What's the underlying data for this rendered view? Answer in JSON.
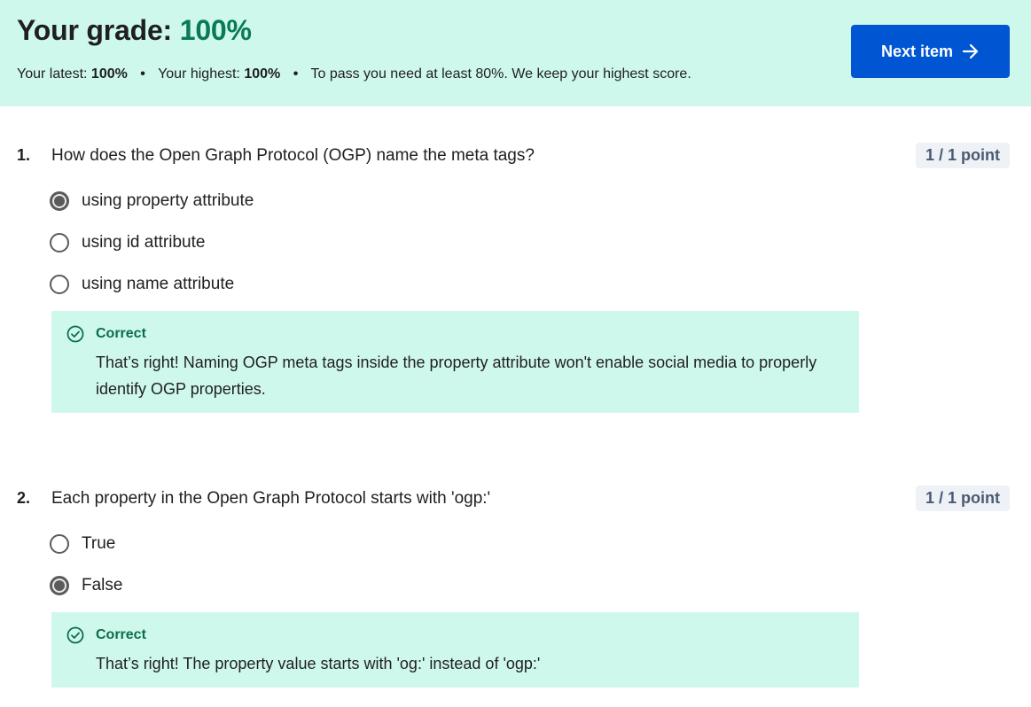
{
  "header": {
    "grade_label": "Your grade:",
    "grade_value": "100%",
    "latest_label": "Your latest:",
    "latest_value": "100%",
    "highest_label": "Your highest:",
    "highest_value": "100%",
    "separator": "•",
    "pass_note": "To pass you need at least 80%. We keep your highest score.",
    "next_button_label": "Next item",
    "next_button_icon": "arrow-right-icon",
    "banner_color": "#cff8ec",
    "accent_color": "#0056d2",
    "grade_color": "#0a7a55"
  },
  "questions": [
    {
      "number": "1.",
      "text": "How does the Open Graph Protocol (OGP) name the meta tags?",
      "points": "1 / 1 point",
      "options": [
        {
          "label": "using property attribute",
          "selected": true
        },
        {
          "label": "using id attribute",
          "selected": false
        },
        {
          "label": "using name attribute",
          "selected": false
        }
      ],
      "feedback": {
        "icon": "check-circle-icon",
        "title": "Correct",
        "text": "That’s right! Naming OGP meta tags inside the property attribute won't enable social media to properly identify OGP properties."
      }
    },
    {
      "number": "2.",
      "text": "Each property in the Open Graph Protocol starts with 'ogp:'",
      "points": "1 / 1 point",
      "options": [
        {
          "label": "True",
          "selected": false
        },
        {
          "label": "False",
          "selected": true
        }
      ],
      "feedback": {
        "icon": "check-circle-icon",
        "title": "Correct",
        "text": "That’s right! The property value starts with 'og:' instead of 'ogp:'"
      }
    }
  ]
}
